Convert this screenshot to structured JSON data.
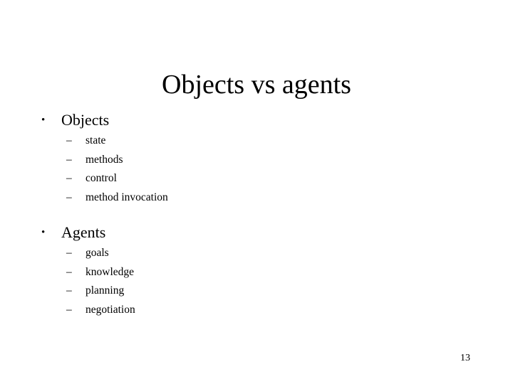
{
  "slide": {
    "title": "Objects vs agents",
    "page_number": "13",
    "background_color": "#ffffff",
    "text_color": "#000000",
    "bullet_glyph": "•",
    "dash_glyph": "–",
    "groups": [
      {
        "label": "Objects",
        "sub_items": [
          {
            "label": "state"
          },
          {
            "label": "methods"
          },
          {
            "label": "control"
          },
          {
            "label": "method invocation"
          }
        ]
      },
      {
        "label": "Agents",
        "sub_items": [
          {
            "label": "goals"
          },
          {
            "label": "knowledge"
          },
          {
            "label": "planning"
          },
          {
            "label": "negotiation"
          }
        ]
      }
    ]
  }
}
